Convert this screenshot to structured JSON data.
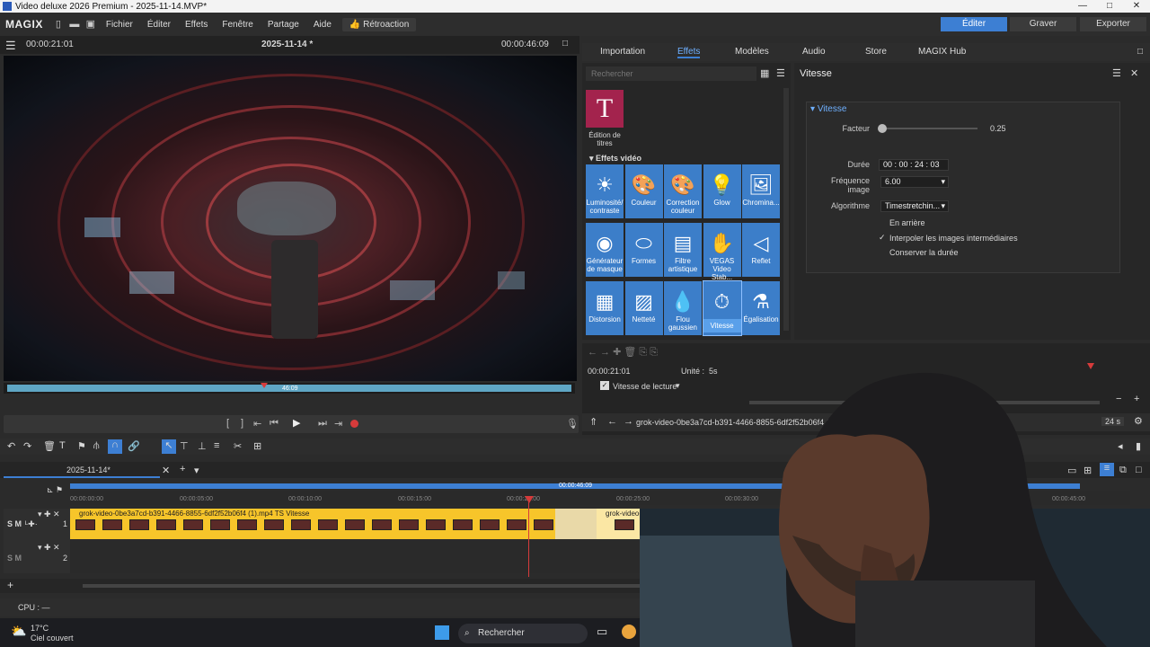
{
  "window": {
    "title": "Video deluxe 2026 Premium - 2025-11-14.MVP*",
    "min": "—",
    "max": "□",
    "close": "✕"
  },
  "menubar": {
    "logo": "MAGIX",
    "items": [
      "Fichier",
      "Éditer",
      "Effets",
      "Fenêtre",
      "Partage",
      "Aide"
    ],
    "feedback": "Rétroaction",
    "modes": [
      "Éditer",
      "Graver",
      "Exporter"
    ]
  },
  "preview": {
    "timecode_left": "00:00:21:01",
    "project": "2025-11-14 *",
    "timecode_right": "00:00:46:09",
    "scrub_label": "46:09"
  },
  "tabs": [
    "Importation",
    "Effets",
    "Modèles",
    "Audio",
    "Store",
    "MAGIX Hub"
  ],
  "effects": {
    "search_placeholder": "Rechercher",
    "title_tile": "Édition de titres",
    "section": "Effets vidéo",
    "tiles": [
      [
        "Luminosité/ contraste",
        "Couleur",
        "Correction couleur",
        "Glow",
        "Chromina..."
      ],
      [
        "Générateur de masque",
        "Formes",
        "Filtre artistique",
        "VEGAS Video Stab...",
        "Reflet"
      ],
      [
        "Distorsion",
        "Netteté",
        "Flou gaussien",
        "Vitesse",
        "Égalisation"
      ]
    ]
  },
  "vitesse": {
    "header": "Vitesse",
    "section": "Vitesse",
    "facteur_label": "Facteur",
    "facteur_value": "0.25",
    "duree_label": "Durée",
    "duree_value": "00 : 00 : 24 : 03",
    "freq_label": "Fréquence image",
    "freq_value": "6.00",
    "algo_label": "Algorithme",
    "algo_value": "Timestretchin...",
    "opt1": "En arrière",
    "opt2": "Interpoler les images intermédiaires",
    "opt3": "Conserver la durée"
  },
  "keyframes": {
    "time": "00:00:21:01",
    "unit_label": "Unité :",
    "unit_value": "5s",
    "param": "Vitesse de lecture",
    "clipname": "grok-video-0be3a7cd-b391-4466-8855-6df2f52b06f4 (1).m",
    "speed": "24 s"
  },
  "timeline": {
    "tab": "2025-11-14*",
    "ruler_end": "00:00:46:09",
    "ticks": [
      "00:00:00:00",
      "00:00:05:00",
      "00:00:10:00",
      "00:00:15:00",
      "00:00:20:00",
      "00:00:25:00",
      "00:00:30:00",
      "00:00:45:00"
    ],
    "clip1": "grok-video-0be3a7cd-b391-4466-8855-6df2f52b06f4 (1).mp4 TS   Vitesse",
    "clip2": "grok-video-0be3a7cd-b391-4466-8855-6df2f52b06f4 (1).mp4",
    "track1": "1",
    "track2": "2",
    "sm": "S M",
    "cpu": "CPU : —"
  },
  "taskbar": {
    "temp": "17°C",
    "weather": "Ciel couvert",
    "search": "Rechercher"
  },
  "colors": {
    "accent": "#3d7fd3",
    "clip": "#f7c52a",
    "playhead": "#d63b3b"
  }
}
